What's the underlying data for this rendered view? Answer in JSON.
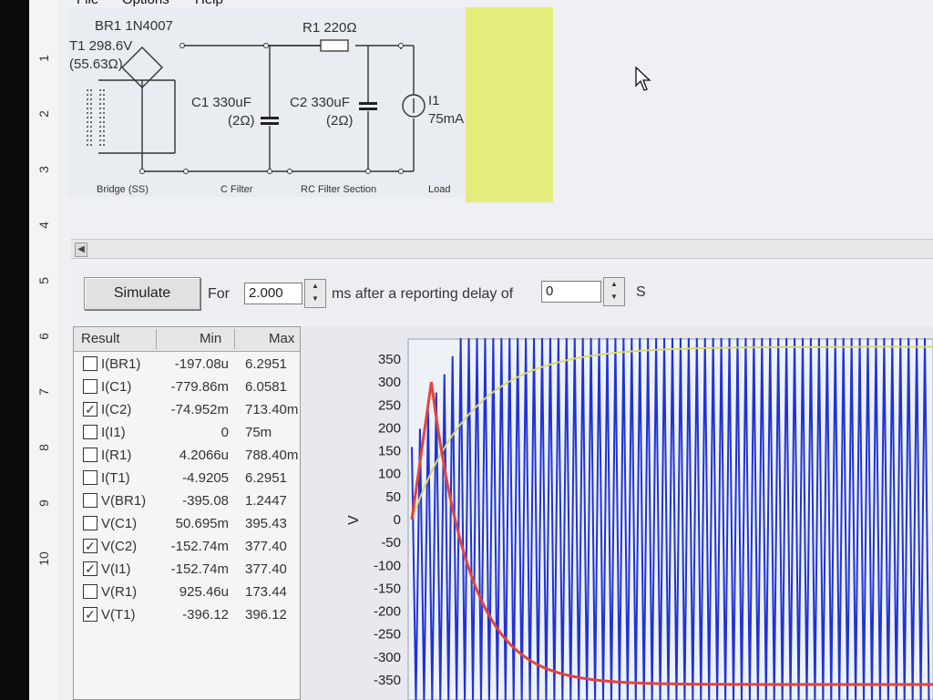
{
  "menu": {
    "file": "File",
    "options": "Options",
    "help": "Help"
  },
  "ruler_ticks": [
    "1",
    "2",
    "3",
    "4",
    "5",
    "6",
    "7",
    "8",
    "9",
    "10"
  ],
  "circuit": {
    "bridge_title": "BR1 1N4007",
    "transformer": "T1 298.6V",
    "transformer_r": "(55.63Ω)",
    "r1": "R1 220Ω",
    "c1": "C1 330uF",
    "c1_esr": "(2Ω)",
    "c2": "C2 330uF",
    "c2_esr": "(2Ω)",
    "load_name": "I1",
    "load_value": "75mA",
    "section_bridge": "Bridge (SS)",
    "section_cfilter": "C Filter",
    "section_rc": "RC Filter Section",
    "section_load": "Load",
    "load_color": "#e4ec7b"
  },
  "controls": {
    "simulate_label": "Simulate",
    "for_label": "For",
    "duration_value": "2.000",
    "after_label": "ms  after a reporting delay of",
    "delay_value": "0",
    "units_label": "S"
  },
  "results": {
    "headers": {
      "result": "Result",
      "min": "Min",
      "max": "Max"
    },
    "rows": [
      {
        "name": "I(BR1)",
        "min": "-197.08u",
        "max": "6.2951",
        "checked": false
      },
      {
        "name": "I(C1)",
        "min": "-779.86m",
        "max": "6.0581",
        "checked": false
      },
      {
        "name": "I(C2)",
        "min": "-74.952m",
        "max": "713.40m",
        "checked": true
      },
      {
        "name": "I(I1)",
        "min": "0",
        "max": "75m",
        "checked": false
      },
      {
        "name": "I(R1)",
        "min": "4.2066u",
        "max": "788.40m",
        "checked": false
      },
      {
        "name": "I(T1)",
        "min": "-4.9205",
        "max": "6.2951",
        "checked": false
      },
      {
        "name": "V(BR1)",
        "min": "-395.08",
        "max": "1.2447",
        "checked": false
      },
      {
        "name": "V(C1)",
        "min": "50.695m",
        "max": "395.43",
        "checked": false
      },
      {
        "name": "V(C2)",
        "min": "-152.74m",
        "max": "377.40",
        "checked": true
      },
      {
        "name": "V(I1)",
        "min": "-152.74m",
        "max": "377.40",
        "checked": true
      },
      {
        "name": "V(R1)",
        "min": "925.46u",
        "max": "173.44",
        "checked": false
      },
      {
        "name": "V(T1)",
        "min": "-396.12",
        "max": "396.12",
        "checked": true
      }
    ]
  },
  "chart_data": {
    "type": "line",
    "ylabel": "V",
    "ylim": [
      -350,
      350
    ],
    "yticks": [
      350,
      300,
      250,
      200,
      150,
      100,
      50,
      0,
      -50,
      -100,
      -150,
      -200,
      -250,
      -300,
      -350
    ],
    "series": [
      {
        "label_ref": "V(T1)",
        "color": "#1f33d6",
        "style": "ac-envelope",
        "amplitude": 396,
        "cycles": 64
      },
      {
        "label_ref": "V(C2)",
        "color": "#d9d96a",
        "style": "charge",
        "final": 377
      },
      {
        "label_ref": "I(C2)",
        "color": "#e5433a",
        "style": "pulse-decay",
        "peak": 300,
        "final": -360
      }
    ]
  }
}
